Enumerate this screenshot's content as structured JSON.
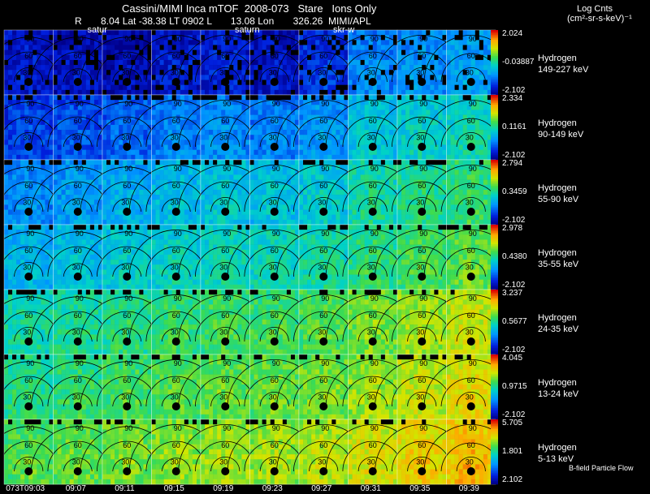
{
  "header": {
    "title": "Cassini/MIMI Inca mTOF  2008-073   Stare   Ions Only",
    "r_line": "R       8.04 Lat -38.38 LT 0902 L       13.08 Lon       326.26  MIMI/APL",
    "units_top": "Log Cnts",
    "units_bottom": "(cm²-sr-s-keV)⁻¹"
  },
  "overlay_labels": [
    {
      "text": "satur",
      "col": 1
    },
    {
      "text": "saturn",
      "col": 4
    },
    {
      "text": "skr-w",
      "col": 6
    }
  ],
  "panel_labels": [
    "90",
    "60",
    "30"
  ],
  "chart_data": {
    "type": "heatmap",
    "description_rows": "energy channels",
    "time_labels": [
      "073T09:03",
      "09:07",
      "09:11",
      "09:15",
      "09:19",
      "09:23",
      "09:27",
      "09:31",
      "09:35",
      "09:39"
    ],
    "rows": [
      {
        "species": "Hydrogen",
        "energy": "149-227 keV",
        "cmax": "2.024",
        "cmid": "-0.03887",
        "cmin": "-2.102",
        "levels": [
          0.12,
          0.1,
          0.08,
          0.13,
          0.14,
          0.11,
          0.18,
          0.3,
          0.33,
          0.36
        ]
      },
      {
        "species": "Hydrogen",
        "energy": "90-149 keV",
        "cmax": "2.334",
        "cmid": "0.1161",
        "cmin": "-2.102",
        "levels": [
          0.2,
          0.22,
          0.25,
          0.3,
          0.32,
          0.3,
          0.34,
          0.44,
          0.47,
          0.5
        ]
      },
      {
        "species": "Hydrogen",
        "energy": "55-90 keV",
        "cmax": "2.794",
        "cmid": "0.3459",
        "cmin": "-2.102",
        "levels": [
          0.32,
          0.35,
          0.38,
          0.42,
          0.44,
          0.43,
          0.46,
          0.52,
          0.55,
          0.58
        ]
      },
      {
        "species": "Hydrogen",
        "energy": "35-55 keV",
        "cmax": "2.978",
        "cmid": "0.4380",
        "cmin": "-2.102",
        "levels": [
          0.4,
          0.43,
          0.46,
          0.48,
          0.5,
          0.5,
          0.52,
          0.57,
          0.6,
          0.63
        ]
      },
      {
        "species": "Hydrogen",
        "energy": "24-35 keV",
        "cmax": "3.237",
        "cmid": "0.5677",
        "cmin": "-2.102",
        "levels": [
          0.52,
          0.54,
          0.56,
          0.58,
          0.6,
          0.6,
          0.62,
          0.66,
          0.7,
          0.74
        ]
      },
      {
        "species": "Hydrogen",
        "energy": "13-24 keV",
        "cmax": "4.045",
        "cmid": "0.9715",
        "cmin": "-2.102",
        "levels": [
          0.56,
          0.58,
          0.6,
          0.62,
          0.64,
          0.64,
          0.66,
          0.7,
          0.74,
          0.78
        ]
      },
      {
        "species": "Hydrogen",
        "energy": "5-13 keV",
        "cmax": "5.705",
        "cmid": "1.801",
        "cmin": "2.102",
        "levels": [
          0.62,
          0.64,
          0.66,
          0.68,
          0.7,
          0.7,
          0.72,
          0.76,
          0.8,
          0.84
        ]
      }
    ]
  },
  "footer": "B-field Particle Flow"
}
